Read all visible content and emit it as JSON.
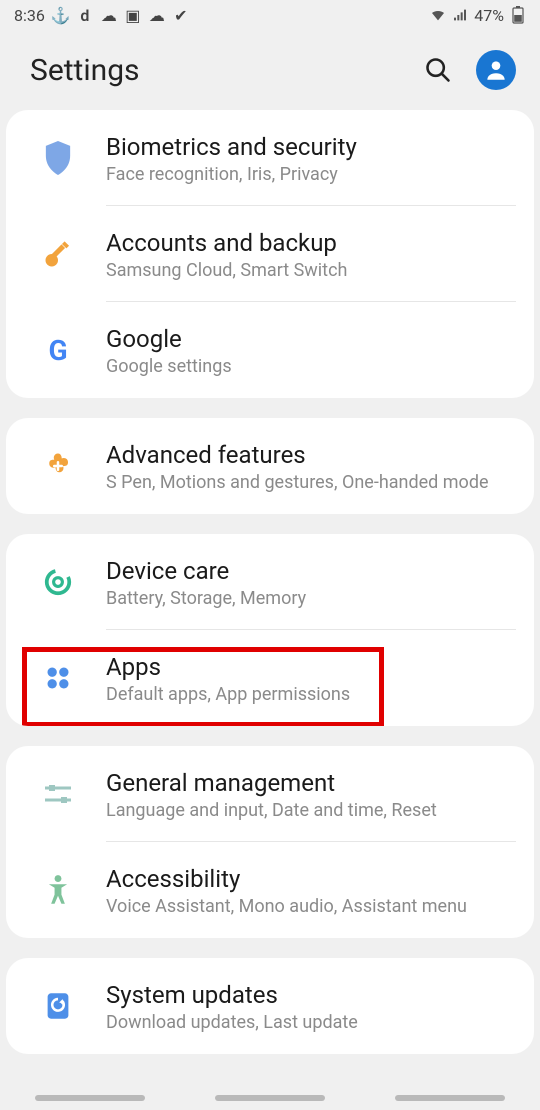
{
  "statusbar": {
    "time": "8:36",
    "battery": "47%"
  },
  "header": {
    "title": "Settings"
  },
  "groups": [
    {
      "items": [
        {
          "title": "Biometrics and security",
          "subtitle": "Face recognition, Iris, Privacy"
        },
        {
          "title": "Accounts and backup",
          "subtitle": "Samsung Cloud, Smart Switch"
        },
        {
          "title": "Google",
          "subtitle": "Google settings"
        }
      ]
    },
    {
      "items": [
        {
          "title": "Advanced features",
          "subtitle": "S Pen, Motions and gestures, One-handed mode"
        }
      ]
    },
    {
      "items": [
        {
          "title": "Device care",
          "subtitle": "Battery, Storage, Memory"
        },
        {
          "title": "Apps",
          "subtitle": "Default apps, App permissions"
        }
      ]
    },
    {
      "items": [
        {
          "title": "General management",
          "subtitle": "Language and input, Date and time, Reset"
        },
        {
          "title": "Accessibility",
          "subtitle": "Voice Assistant, Mono audio, Assistant menu"
        }
      ]
    },
    {
      "items": [
        {
          "title": "System updates",
          "subtitle": "Download updates, Last update"
        }
      ]
    }
  ]
}
